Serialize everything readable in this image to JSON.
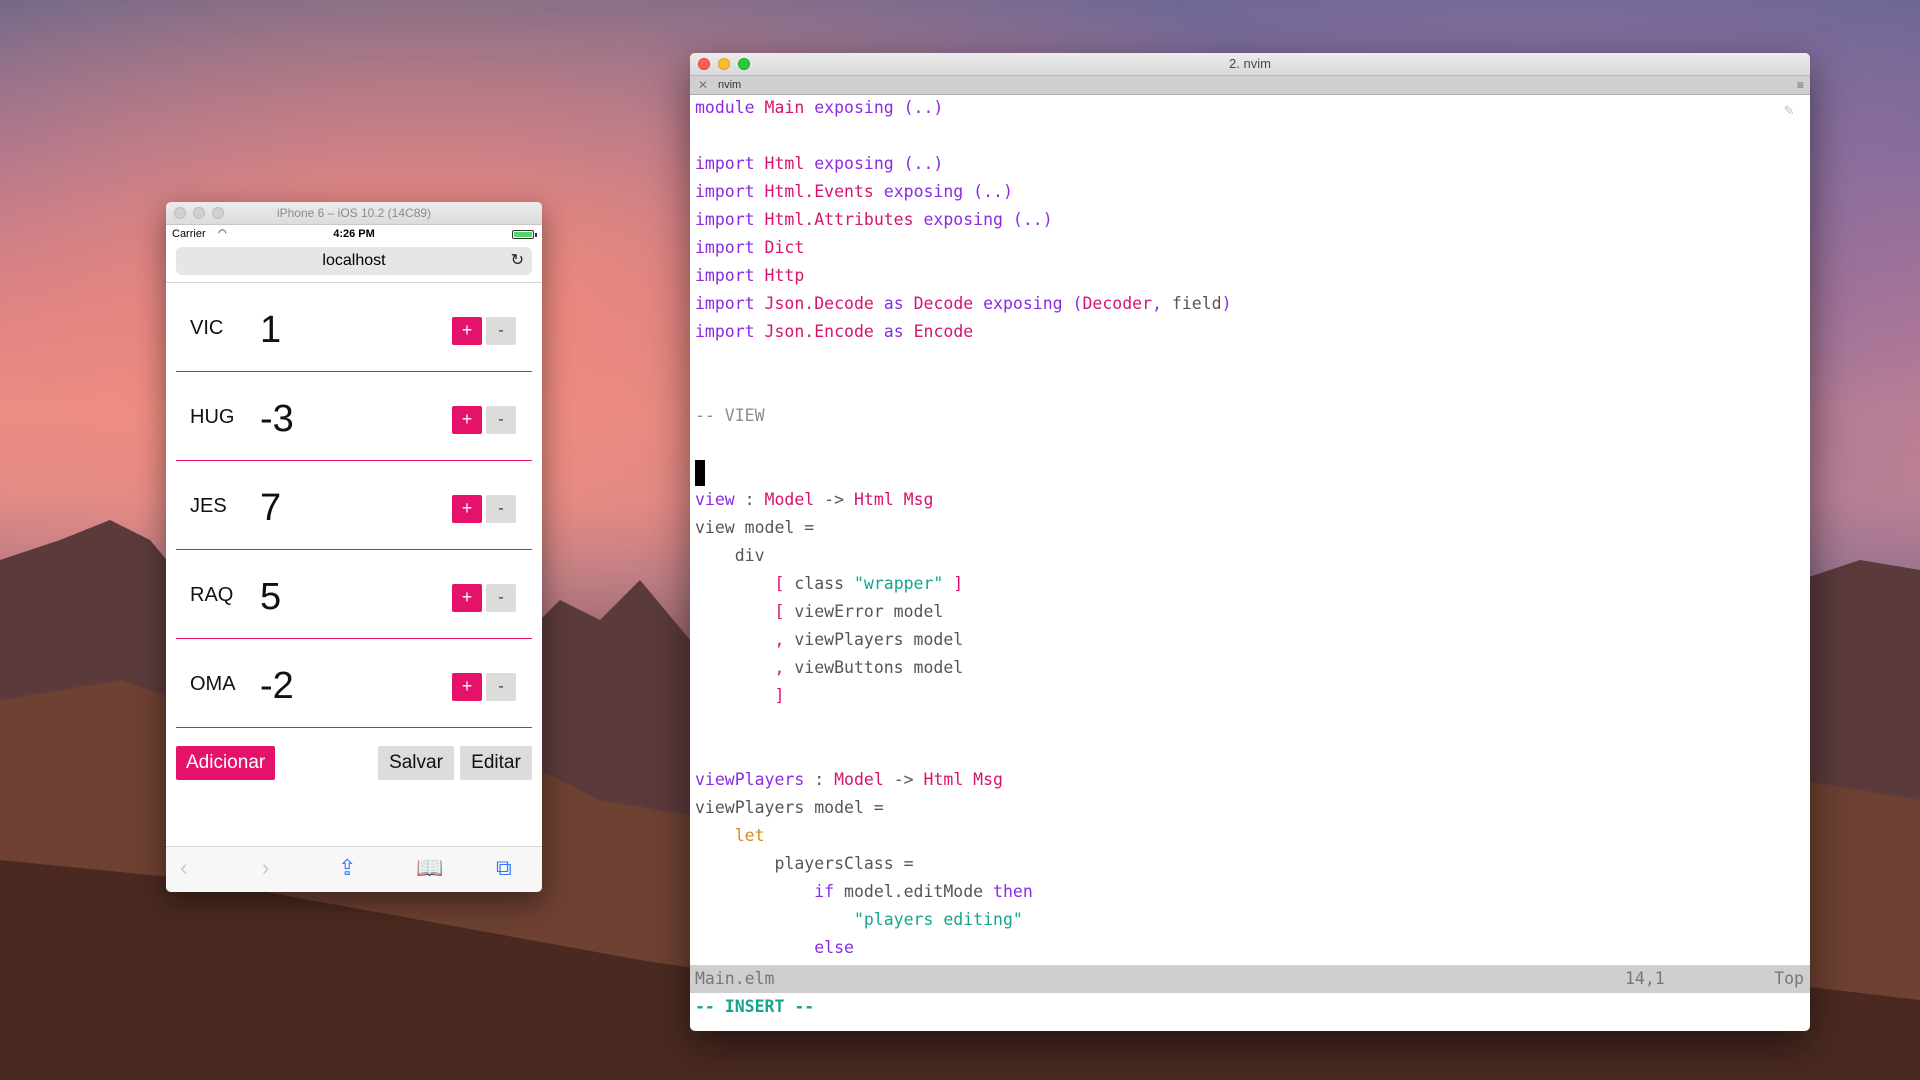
{
  "simulator": {
    "title": "iPhone 6 – iOS 10.2 (14C89)",
    "status": {
      "carrier": "Carrier",
      "time": "4:26 PM"
    },
    "url": "localhost",
    "players": [
      {
        "name": "VIC",
        "score": "1"
      },
      {
        "name": "HUG",
        "score": "-3"
      },
      {
        "name": "JES",
        "score": "7"
      },
      {
        "name": "RAQ",
        "score": "5"
      },
      {
        "name": "OMA",
        "score": "-2"
      }
    ],
    "plus_label": "+",
    "minus_label": "-",
    "add_label": "Adicionar",
    "save_label": "Salvar",
    "edit_label": "Editar",
    "accent": "#e4126b"
  },
  "terminal": {
    "title": "2. nvim",
    "tab_label": "nvim",
    "filename": "Main.elm",
    "position": "14,1",
    "scroll": "Top",
    "mode": "-- INSERT --",
    "code": [
      [
        [
          "kw",
          "module "
        ],
        [
          "ty",
          "Main "
        ],
        [
          "kw",
          "exposing (..)"
        ]
      ],
      [],
      [
        [
          "kw",
          "import "
        ],
        [
          "ty",
          "Html "
        ],
        [
          "kw",
          "exposing (..)"
        ]
      ],
      [
        [
          "kw",
          "import "
        ],
        [
          "ty",
          "Html.Events "
        ],
        [
          "kw",
          "exposing (..)"
        ]
      ],
      [
        [
          "kw",
          "import "
        ],
        [
          "ty",
          "Html.Attributes "
        ],
        [
          "kw",
          "exposing (..)"
        ]
      ],
      [
        [
          "kw",
          "import "
        ],
        [
          "ty",
          "Dict"
        ]
      ],
      [
        [
          "kw",
          "import "
        ],
        [
          "ty",
          "Http"
        ]
      ],
      [
        [
          "kw",
          "import "
        ],
        [
          "ty",
          "Json.Decode "
        ],
        [
          "kw",
          "as "
        ],
        [
          "ty",
          "Decode "
        ],
        [
          "kw",
          "exposing ("
        ],
        [
          "ty",
          "Decoder"
        ],
        [
          "kw",
          ", "
        ],
        [
          "var",
          "field"
        ],
        [
          "kw",
          ")"
        ]
      ],
      [
        [
          "kw",
          "import "
        ],
        [
          "ty",
          "Json.Encode "
        ],
        [
          "kw",
          "as "
        ],
        [
          "ty",
          "Encode"
        ]
      ],
      [],
      [],
      [
        [
          "cm",
          "-- VIEW"
        ]
      ],
      [],
      [
        [
          "cursor",
          ""
        ]
      ],
      [
        [
          "kw",
          "view "
        ],
        [
          "var",
          ": "
        ],
        [
          "ty",
          "Model "
        ],
        [
          "var",
          "-> "
        ],
        [
          "ty",
          "Html Msg"
        ]
      ],
      [
        [
          "var",
          "view model ="
        ]
      ],
      [
        [
          "var",
          "    div"
        ]
      ],
      [
        [
          "ty",
          "        [ "
        ],
        [
          "var",
          "class "
        ],
        [
          "str",
          "\"wrapper\""
        ],
        [
          "ty",
          " ]"
        ]
      ],
      [
        [
          "ty",
          "        [ "
        ],
        [
          "var",
          "viewError model"
        ]
      ],
      [
        [
          "ty",
          "        , "
        ],
        [
          "var",
          "viewPlayers model"
        ]
      ],
      [
        [
          "ty",
          "        , "
        ],
        [
          "var",
          "viewButtons model"
        ]
      ],
      [
        [
          "ty",
          "        ]"
        ]
      ],
      [],
      [],
      [
        [
          "kw",
          "viewPlayers "
        ],
        [
          "var",
          ": "
        ],
        [
          "ty",
          "Model "
        ],
        [
          "var",
          "-> "
        ],
        [
          "ty",
          "Html Msg"
        ]
      ],
      [
        [
          "var",
          "viewPlayers model ="
        ]
      ],
      [
        [
          "let",
          "    let"
        ]
      ],
      [
        [
          "var",
          "        playersClass ="
        ]
      ],
      [
        [
          "kw",
          "            if "
        ],
        [
          "var",
          "model.editMode "
        ],
        [
          "kw",
          "then"
        ]
      ],
      [
        [
          "str",
          "                \"players editing\""
        ]
      ],
      [
        [
          "kw",
          "            else"
        ]
      ]
    ]
  }
}
